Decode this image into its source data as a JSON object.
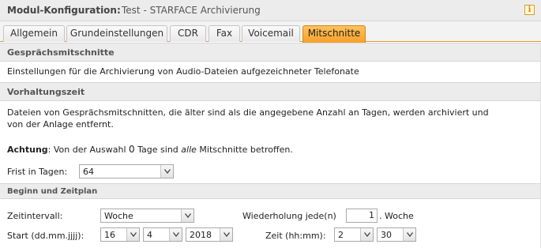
{
  "window": {
    "title_label": "Modul-Konfiguration:",
    "title_value": "Test - STARFACE Archivierung",
    "info_icon": "info-icon"
  },
  "tabs": [
    {
      "label": "Allgemein",
      "active": false
    },
    {
      "label": "Grundeinstellungen",
      "active": false
    },
    {
      "label": "CDR",
      "active": false
    },
    {
      "label": "Fax",
      "active": false
    },
    {
      "label": "Voicemail",
      "active": false
    },
    {
      "label": "Mitschnitte",
      "active": true
    }
  ],
  "sections": {
    "gespraech": {
      "title": "Gesprächsmitschnitte",
      "description": "Einstellungen für die Archivierung von Audio-Dateien aufgezeichneter Telefonate"
    },
    "vorhaltung": {
      "title": "Vorhaltungszeit",
      "description_line1": "Dateien von Gesprächsmitschnitten, die älter sind als die angegebene Anzahl an Tagen, werden archiviert und",
      "description_line2": "von der Anlage entfernt.",
      "warning_bold": "Achtung",
      "warning_text1": ": Von der Auswahl ",
      "warning_number": "0",
      "warning_text2": " Tage sind ",
      "warning_italic": "alle",
      "warning_text3": " Mitschnitte betroffen.",
      "frist_label": "Frist in Tagen:",
      "frist_value": "64"
    },
    "zeitplan": {
      "title": "Beginn und Zeitplan",
      "intervall_label": "Zeitintervall:",
      "intervall_value": "Woche",
      "wiederholung_label": "Wiederholung jede(n)",
      "wiederholung_value": "1",
      "wiederholung_unit": ". Woche",
      "start_label": "Start (dd.mm.jjjj):",
      "start_day": "16",
      "start_month": "4",
      "start_year": "2018",
      "zeit_label": "Zeit (hh:mm):",
      "zeit_hour": "2",
      "zeit_minute": "30"
    }
  },
  "colors": {
    "active_tab": "#f6a02a",
    "header_bg": "#ececec",
    "info_icon": "#d7a12c"
  }
}
